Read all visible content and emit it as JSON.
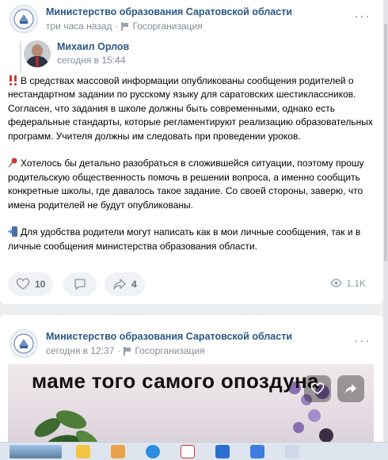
{
  "post1": {
    "source": {
      "name": "Министерство образования Саратовской области",
      "time": "три часа назад",
      "badge": "Госорганизация"
    },
    "author": {
      "name": "Михаил Орлов",
      "time": "сегодня в 15:44"
    },
    "paragraphs": [
      {
        "emoji": "double-exclamation",
        "text": "В средствах массовой информации опубликованы сообщения родителей о нестандартном задании по русскому языку для саратовских шестиклассников. Согласен, что задания в школе должны быть современными, однако есть федеральные стандарты, которые регламентируют реализацию образовательных программ. Учителя должны им следовать при проведении уроков."
      },
      {
        "emoji": "pushpin",
        "text": "Хотелось бы детально разобраться в сложившейся ситуации, поэтому прошу родительскую общественность помочь в решении вопроса, а именно сообщить конкретные школы, где давалось такое задание. Со своей стороны, заверю, что имена родителей не будут опубликованы."
      },
      {
        "emoji": "mobile-arrow",
        "text": "Для удобства родители могут написать как в мои личные сообщения, так и в личные сообщения министерства образования области."
      }
    ],
    "actions": {
      "likes": "10",
      "comments": "",
      "shares": "4",
      "views": "1.1K"
    }
  },
  "post2": {
    "source": {
      "name": "Министерство образования Саратовской области",
      "time": "сегодня в 12:37",
      "badge": "Госорганизация"
    },
    "video_caption": "маме того самого опоздуна"
  },
  "icons": {
    "like": "heart-icon",
    "comment": "comment-icon",
    "share": "share-arrow-icon",
    "views": "eye-icon",
    "more": "more-dots-icon"
  },
  "colors": {
    "link": "#2a5885",
    "meta": "#818c99",
    "background": "#edeef0"
  }
}
